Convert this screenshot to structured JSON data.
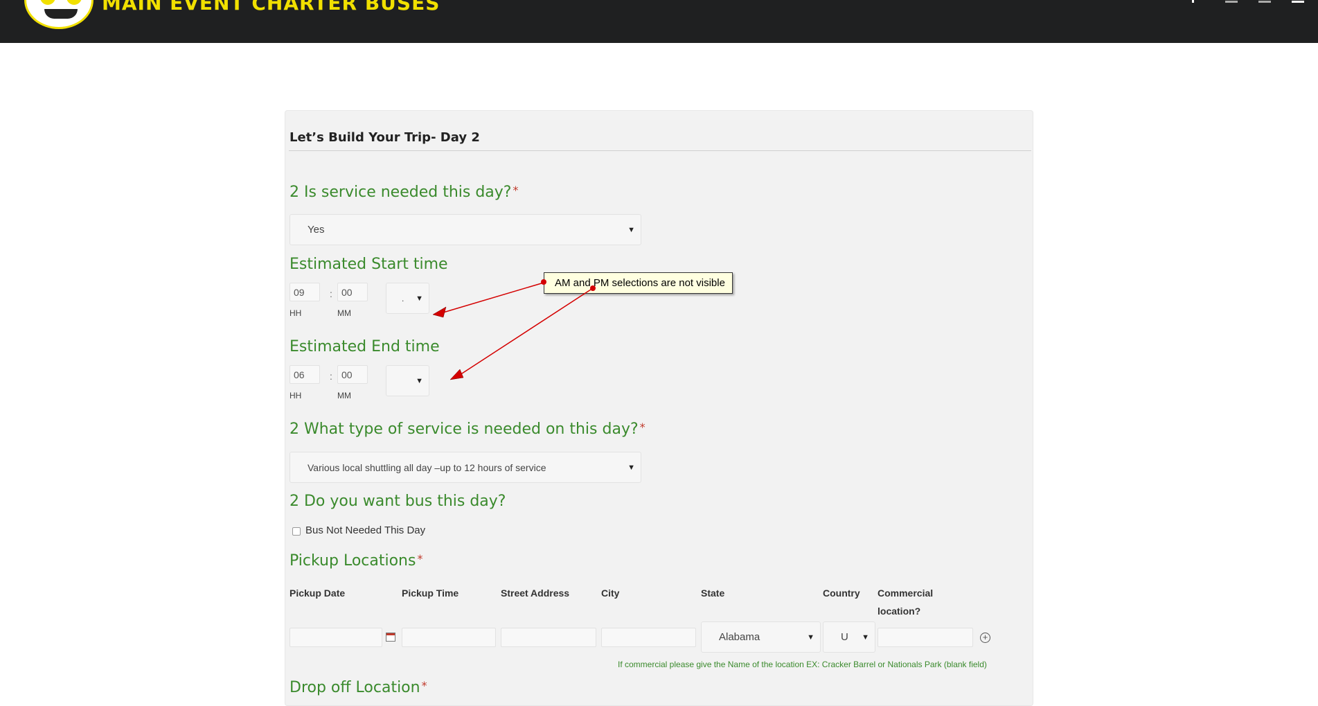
{
  "header": {
    "brand": "MAIN EVENT CHARTER BUSES"
  },
  "form": {
    "section_title": "Let’s Build Your Trip- Day 2",
    "q_service_needed": {
      "label": "2 Is service needed this day?",
      "required_mark": "*",
      "value": "Yes"
    },
    "start_time": {
      "label": "Estimated Start time",
      "hh": "09",
      "mm": "00",
      "hh_label": "HH",
      "mm_label": "MM",
      "ampm_value": "."
    },
    "end_time": {
      "label": "Estimated End time",
      "hh": "06",
      "mm": "00",
      "hh_label": "HH",
      "mm_label": "MM",
      "ampm_value": ""
    },
    "q_service_type": {
      "label": "2 What type of service is needed on this day?",
      "required_mark": "*",
      "value": "Various local shuttling all day –up to 12 hours of service"
    },
    "q_bus": {
      "label": "2 Do you want bus this day?",
      "checkbox_label": "Bus Not Needed This Day"
    },
    "pickup": {
      "label": "Pickup Locations",
      "required_mark": "*",
      "columns": [
        "Pickup Date",
        "Pickup Time",
        "Street Address",
        "City",
        "State",
        "Country",
        "Commercial location?"
      ],
      "state_value": "Alabama",
      "country_value": "U",
      "hint": "If commercial please give the Name of the location EX: Cracker Barrel or Nationals Park (blank field)"
    },
    "dropoff": {
      "label": "Drop off Location",
      "required_mark": "*"
    }
  },
  "annotation": {
    "text": "AM and PM selections are not visible"
  },
  "colors": {
    "header_bg": "#1f2021",
    "brand_yellow": "#f1e000",
    "question_green": "#3a8a2c",
    "annotation_bg": "#ffffe0",
    "arrow_red": "#d40000"
  }
}
